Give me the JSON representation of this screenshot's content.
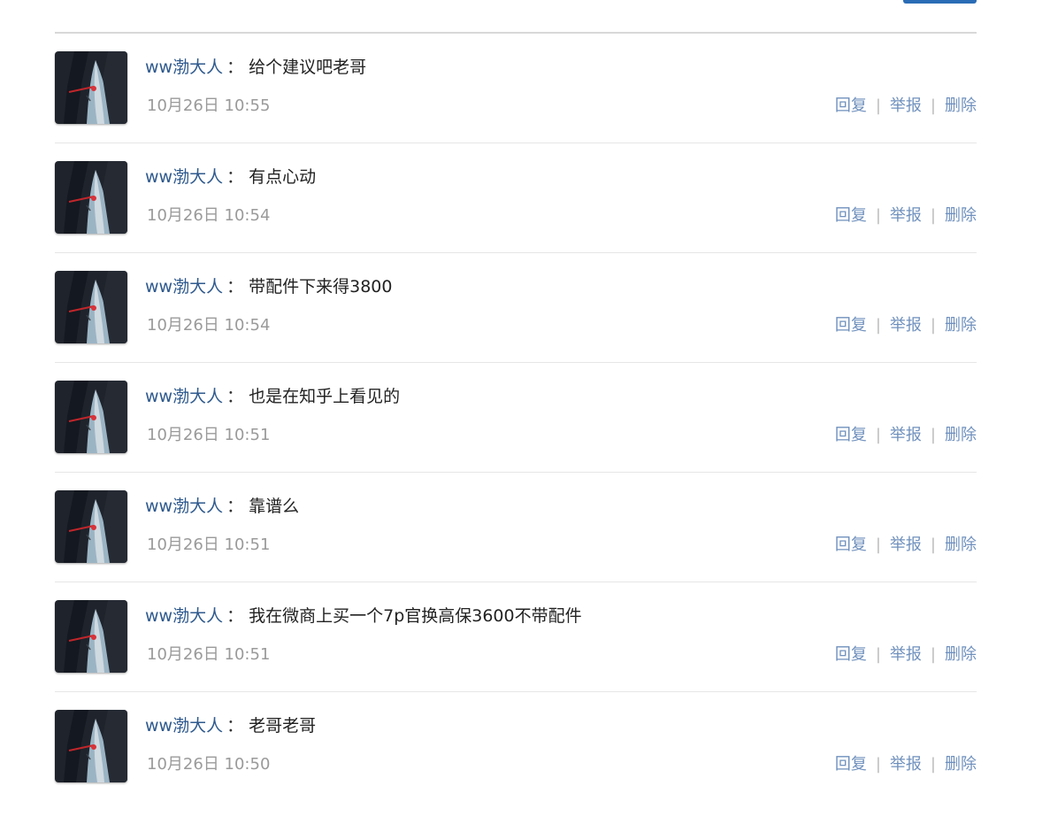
{
  "actions": {
    "reply": "回复",
    "separator": "|",
    "report": "举报",
    "delete": "删除"
  },
  "colon": "：",
  "comments": [
    {
      "user": "ww渤大人",
      "message": "给个建议吧老哥",
      "time": "10月26日 10:55"
    },
    {
      "user": "ww渤大人",
      "message": "有点心动",
      "time": "10月26日 10:54"
    },
    {
      "user": "ww渤大人",
      "message": "带配件下来得3800",
      "time": "10月26日 10:54"
    },
    {
      "user": "ww渤大人",
      "message": "也是在知乎上看见的",
      "time": "10月26日 10:51"
    },
    {
      "user": "ww渤大人",
      "message": "靠谱么",
      "time": "10月26日 10:51"
    },
    {
      "user": "ww渤大人",
      "message": "我在微商上买一个7p官换高保3600不带配件",
      "time": "10月26日 10:51"
    },
    {
      "user": "ww渤大人",
      "message": "老哥老哥",
      "time": "10月26日 10:50"
    }
  ]
}
